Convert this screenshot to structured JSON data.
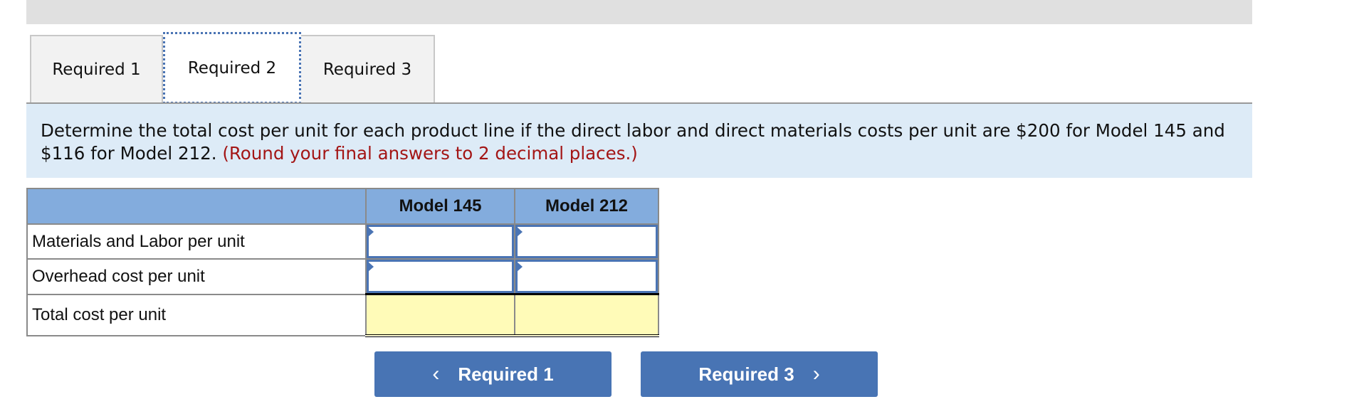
{
  "tabs": [
    {
      "label": "Required 1",
      "active": false
    },
    {
      "label": "Required 2",
      "active": true
    },
    {
      "label": "Required 3",
      "active": false
    }
  ],
  "instructions": {
    "text": "Determine the total cost per unit for each product line if the direct labor and direct materials costs per unit are $200 for Model 145 and $116 for Model 212.",
    "note": "(Round your final answers to 2 decimal places.)"
  },
  "table": {
    "headers": [
      "",
      "Model 145",
      "Model 212"
    ],
    "rows": [
      {
        "label": "Materials and Labor per unit",
        "values": [
          "",
          ""
        ]
      },
      {
        "label": "Overhead cost per unit",
        "values": [
          "",
          ""
        ]
      },
      {
        "label": "Total cost per unit",
        "values": [
          "",
          ""
        ]
      }
    ]
  },
  "nav": {
    "prev_label": "Required 1",
    "next_label": "Required 3",
    "prev_icon": "‹",
    "next_icon": "›"
  },
  "colors": {
    "accent": "#4874b4",
    "header_bg": "#83acdd",
    "panel_bg": "#ddebf7",
    "total_bg": "#fffbb8",
    "note_red": "#a31515"
  }
}
